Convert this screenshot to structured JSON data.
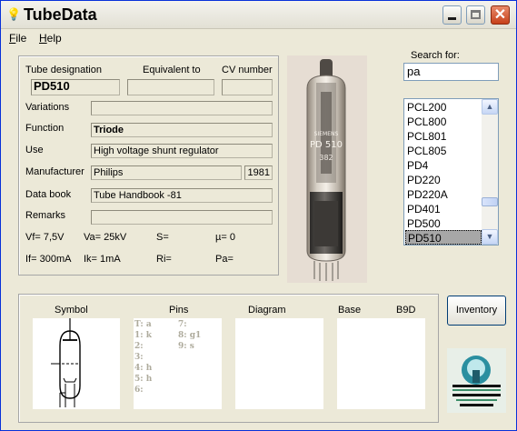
{
  "app": {
    "title": "TubeData",
    "close_glyph": "✕"
  },
  "menu": [
    {
      "label": "File",
      "mnemonic": "F",
      "rest": "ile"
    },
    {
      "label": "Help",
      "mnemonic": "H",
      "rest": "elp"
    }
  ],
  "details": {
    "tube_designation_label": "Tube designation",
    "equivalent_label": "Equivalent to",
    "cv_label": "CV number",
    "tube_designation": "PD510",
    "equivalent": "",
    "cv_number": "",
    "variations_label": "Variations",
    "variations": "",
    "function_label": "Function",
    "function": "Triode",
    "use_label": "Use",
    "use": "High voltage shunt regulator",
    "manufacturer_label": "Manufacturer",
    "manufacturer": "Philips",
    "year": "1981",
    "databook_label": "Data book",
    "databook": "Tube Handbook -81",
    "remarks_label": "Remarks",
    "remarks": "",
    "params": {
      "vf": "Vf= 7,5V",
      "va": "Va= 25kV",
      "s": "S=",
      "mu": "µ=   0",
      "if": "If= 300mA",
      "ik": "Ik=  1mA",
      "ri": "Ri=",
      "pa": "Pa="
    }
  },
  "photo": {
    "label_line1": "SIEMENS",
    "label_line2": "PD 510",
    "label_line3": "382"
  },
  "search": {
    "label": "Search for:",
    "value": "pa"
  },
  "results": [
    "PCL200",
    "PCL800",
    "PCL801",
    "PCL805",
    "PD4",
    "PD220",
    "PD220A",
    "PD401",
    "PD500",
    "PD510"
  ],
  "selected_result": "PD510",
  "scroll": {
    "up": "▲",
    "down": "▼"
  },
  "bottom": {
    "symbol_label": "Symbol",
    "pins_label": "Pins",
    "diagram_label": "Diagram",
    "base_label": "Base",
    "base_value": "B9D",
    "pins_left": [
      "T: a",
      "1: k",
      "2:",
      "3:",
      "4: h",
      "5: h",
      "6:"
    ],
    "pins_right": [
      "7:",
      "8: g1",
      "9: s"
    ]
  },
  "inventory_button": "Inventory"
}
